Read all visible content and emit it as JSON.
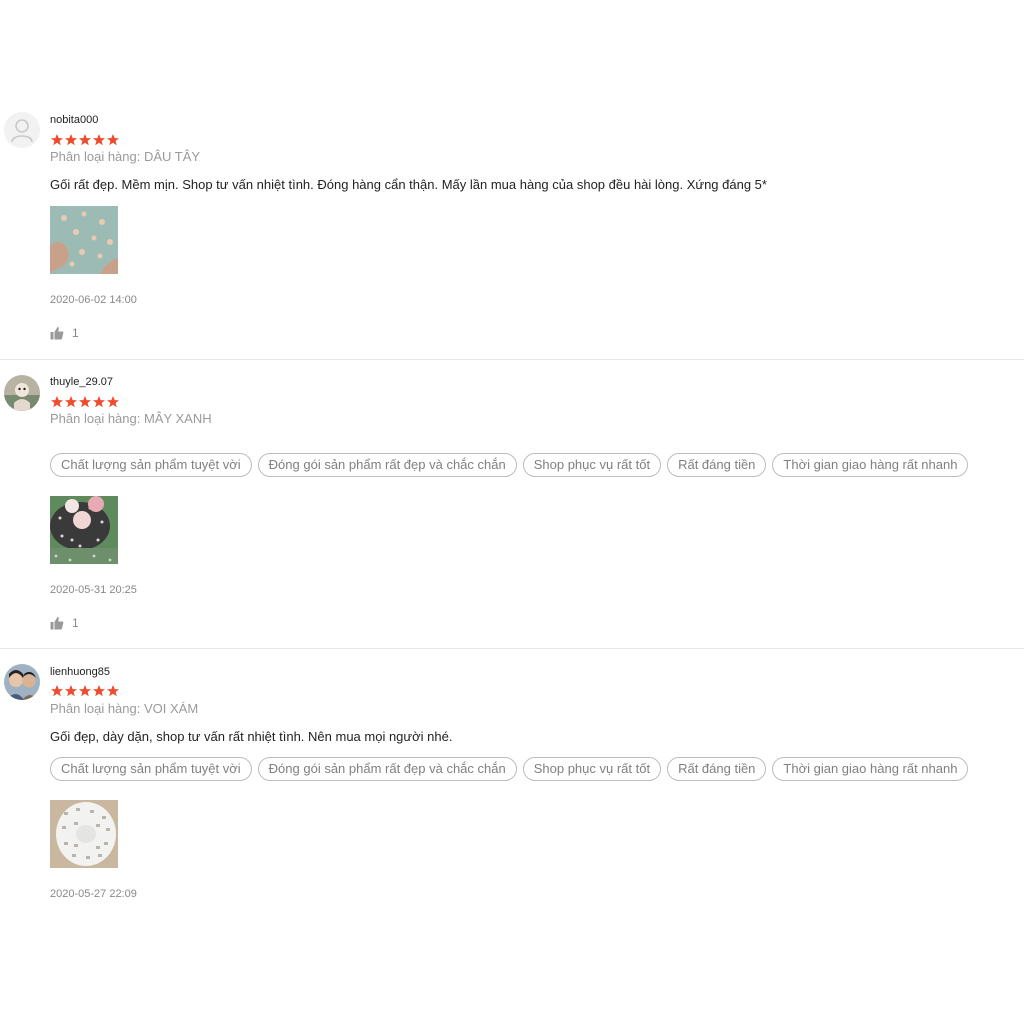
{
  "reviews": [
    {
      "username": "nobita000",
      "rating": 5,
      "variant": "Phân loại hàng: DÂU TÂY",
      "comment": "Gối rất đẹp. Mềm mịn. Shop tư vấn nhiệt tình. Đóng hàng cẩn thận. Mấy lần mua hàng của shop đều hài lòng. Xứng đáng 5*",
      "date": "2020-06-02 14:00",
      "likes": "1"
    },
    {
      "username": "thuyle_29.07",
      "rating": 5,
      "variant": "Phân loại hàng: MÂY XANH",
      "tags": [
        "Chất lượng sản phẩm tuyệt vời",
        "Đóng gói sản phẩm rất đẹp và chắc chắn",
        "Shop phục vụ rất tốt",
        "Rất đáng tiền",
        "Thời gian giao hàng rất nhanh"
      ],
      "date": "2020-05-31 20:25",
      "likes": "1"
    },
    {
      "username": "lienhuong85",
      "rating": 5,
      "variant": "Phân loại hàng: VOI XÁM",
      "comment": "Gối đẹp, dày dặn, shop tư vấn rất nhiệt tình. Nên mua mọi người nhé.",
      "tags": [
        "Chất lượng sản phẩm tuyệt vời",
        "Đóng gói sản phẩm rất đẹp và chắc chắn",
        "Shop phục vụ rất tốt",
        "Rất đáng tiền",
        "Thời gian giao hàng rất nhanh"
      ],
      "date": "2020-05-27 22:09"
    }
  ],
  "colors": {
    "star": "#ee4d2d",
    "muted": "#888888",
    "tag_border": "#bdbdbd"
  }
}
